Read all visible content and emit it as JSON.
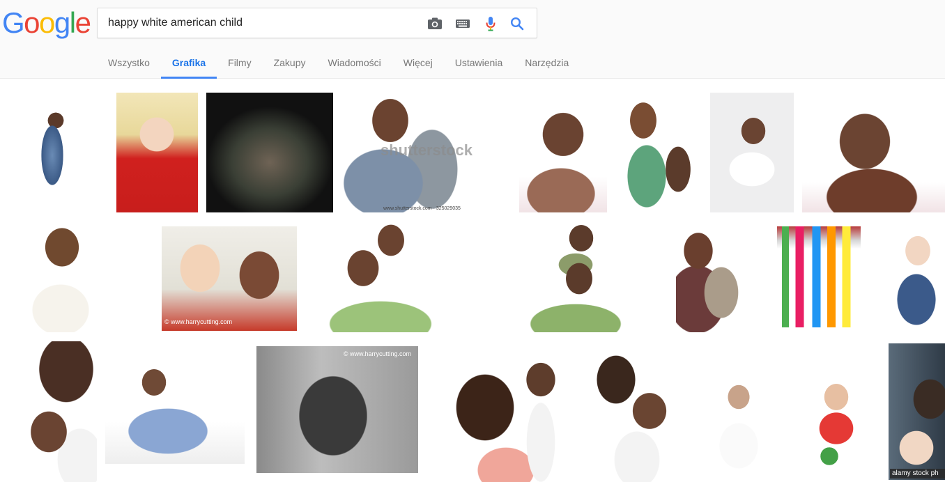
{
  "logo": {
    "letters": [
      "G",
      "o",
      "o",
      "g",
      "l",
      "e"
    ]
  },
  "colors": {
    "blue": "#4285f4",
    "red": "#ea4335",
    "yellow": "#fbbc05",
    "green": "#34a853",
    "active_tab": "#1a73e8"
  },
  "search": {
    "query": "happy white american child",
    "icons": [
      "camera-icon",
      "keyboard-icon",
      "microphone-icon",
      "search-icon"
    ]
  },
  "tabs": [
    {
      "label": "Wszystko"
    },
    {
      "label": "Grafika",
      "active": true
    },
    {
      "label": "Filmy"
    },
    {
      "label": "Zakupy"
    },
    {
      "label": "Wiadomości"
    },
    {
      "label": "Więcej"
    },
    {
      "label": "Ustawienia"
    },
    {
      "label": "Narzędzia"
    }
  ],
  "overlays": {
    "shutterstock": "shutterstock",
    "shutterstock_id": "www.shutterstock.com · 325029035",
    "harrycutting_1": "© www.harrycutting.com",
    "harrycutting_2": "© www.harrycutting.com",
    "alamy": "alamy stock ph"
  }
}
